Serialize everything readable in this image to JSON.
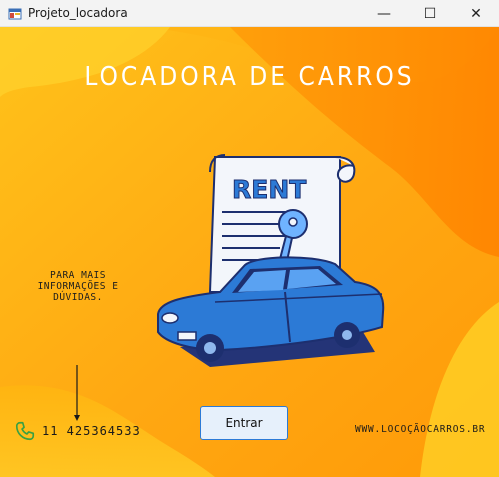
{
  "window": {
    "title": "Projeto_locadora",
    "minimize_glyph": "—",
    "maximize_glyph": "☐",
    "close_glyph": "✕"
  },
  "main": {
    "heading": "LOCADORA DE CARROS",
    "info_lines": [
      "PARA MAIS",
      "INFORMAÇÕES E",
      "DÚVIDAS."
    ],
    "phone": "11  425364533",
    "enter_button": "Entrar",
    "website": "WWW.LOCOÇÃOCARROS.BR",
    "rent_label": "RENT"
  },
  "icons": {
    "app": "app-window-icon",
    "phone": "phone-icon",
    "arrow": "arrow-down-icon",
    "illustration": "rent-car-key-illustration"
  },
  "colors": {
    "bg_gradient_light": "#ffc21a",
    "bg_gradient_dark": "#ff8f00",
    "accent_blue": "#2c7ad6",
    "phone_green": "#3aa042"
  }
}
